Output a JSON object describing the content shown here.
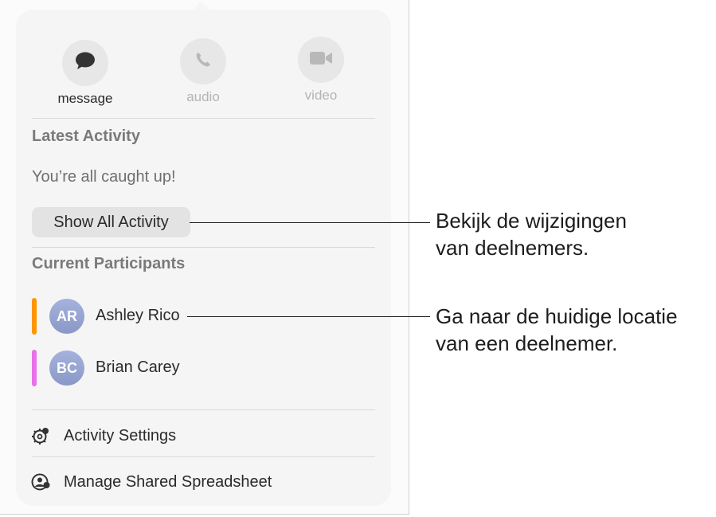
{
  "actions": {
    "message_label": "message",
    "audio_label": "audio",
    "video_label": "video"
  },
  "activity": {
    "section_title": "Latest Activity",
    "status_text": "You’re all caught up!",
    "show_all_label": "Show All Activity"
  },
  "participants": {
    "section_title": "Current Participants",
    "items": [
      {
        "initials": "AR",
        "name": "Ashley Rico",
        "color": "#ff9500"
      },
      {
        "initials": "BC",
        "name": "Brian Carey",
        "color": "#e870e8"
      }
    ]
  },
  "menu": {
    "settings_label": "Activity Settings",
    "manage_label": "Manage Shared Spreadsheet"
  },
  "callouts": {
    "first_line1": "Bekijk de wijzigingen",
    "first_line2": "van deelnemers.",
    "second_line1": "Ga naar de huidige locatie",
    "second_line2": "van een deelnemer."
  }
}
